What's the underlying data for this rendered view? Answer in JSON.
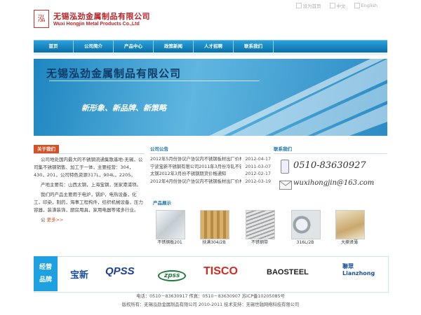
{
  "header": {
    "logo_glyph": "泓",
    "company_cn": "无锡泓劲金属制品有限公司",
    "company_en": "Wuxi Hongjin Metal Products Co.,Ltd",
    "toplinks": [
      "设为首页",
      "中文",
      "English"
    ]
  },
  "nav": [
    "首页",
    "公司简介",
    "产品中心",
    "政策新闻",
    "人才招聘",
    "联系我们"
  ],
  "banner": {
    "title": "无锡泓劲金属制品有限公司",
    "slogan": "新形象、新品牌、新策略"
  },
  "about": {
    "heading": "关于我们",
    "paragraphs": [
      "公司地处国内最大的不锈钢流通集散基地-无锡，公司集不锈钢销售、加工于一体，主要经营：304，430，201，公司特色资源317L，904L，2205。",
      "产地主要有：山西太钢，上海宝钢，张家港浦项。",
      "我们的产品主要用于电炉，锅炉，电热设备，化工，印染，制药，海事工程构件，纺织机械设备，压力容器，装潢装饰，厨房用具，家用电器等诸多行业。"
    ],
    "more": "更多>>"
  },
  "news": {
    "heading": "公司公告",
    "items": [
      {
        "title": "2012年5月份协议户协议内不锈钢板材出厂价格",
        "date": "2012-04-17"
      },
      {
        "title": "宁波宝新不锈钢有限公司2011年3月份冷轧不锈",
        "date": "2011-03-07"
      },
      {
        "title": "太钢2012年3月份不锈钢期货价格通知",
        "date": "2012-02-17"
      },
      {
        "title": "2012年4月份协议户协议内不锈钢板材出厂价格",
        "date": "2012-03-19"
      }
    ]
  },
  "products": {
    "heading": "产品展示",
    "items": [
      "不锈钢板201",
      "扶满304/2B",
      "不锈钢带",
      "316L/2B",
      "大撕贤薄"
    ]
  },
  "contact": {
    "heading": "联系我们",
    "phone": "0510-83630927",
    "email": "wuxihongjin@163.com"
  },
  "brands": {
    "label_line1": "经营",
    "label_line2": "品牌",
    "items": [
      "宝新",
      "QPSS",
      "zpss",
      "TISCO",
      "BAOSTEEL",
      "聯眾 Lianzhong"
    ]
  },
  "footer": {
    "line1": "电话：0510－83630917 传真：0510－83630907 苏ICP备10205085号",
    "line2": "版权所有：无锡泓劲金属制品有限公司 2010-2011 技术支持：无锡世融网络科技有限公司"
  },
  "colors": {
    "nav_blue": "#1e86c0",
    "accent_orange": "#d94f22",
    "brand_red": "#b8262b"
  }
}
